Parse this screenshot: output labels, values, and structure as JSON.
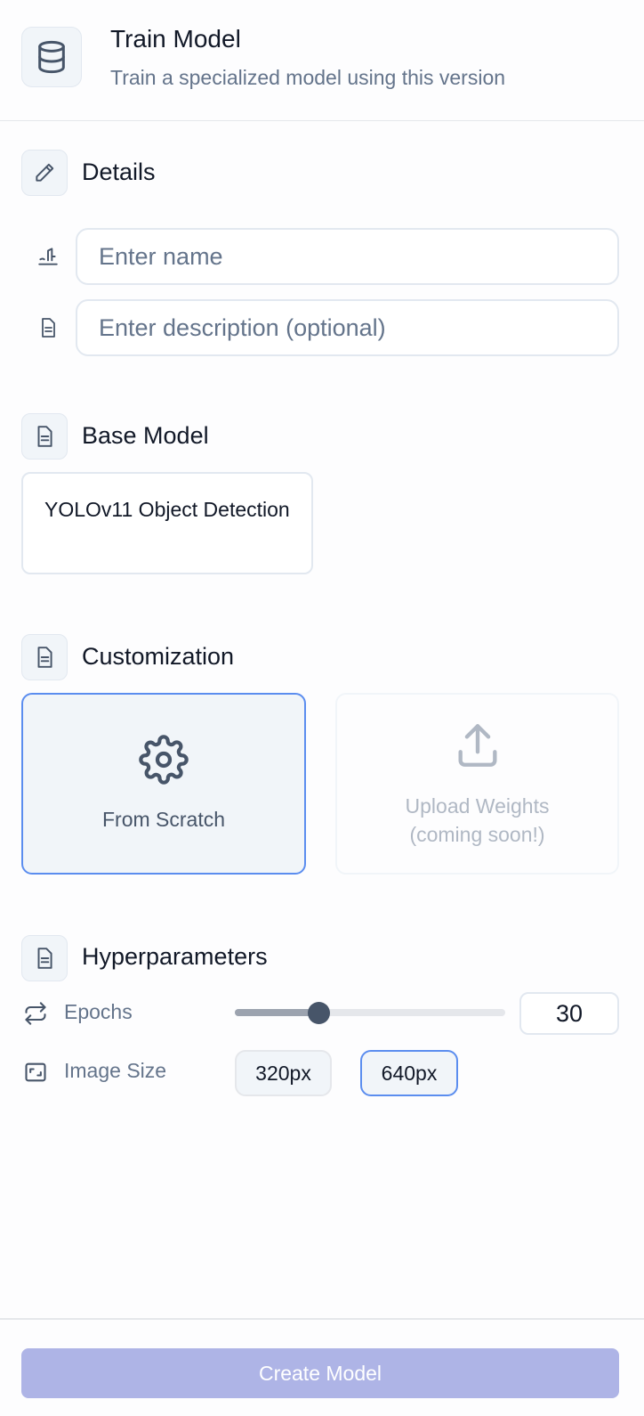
{
  "header": {
    "title": "Train Model",
    "subtitle": "Train a specialized model using this version",
    "icon": "database-icon"
  },
  "details": {
    "title": "Details",
    "icon": "pencil-icon",
    "name_field": {
      "placeholder": "Enter name",
      "value": "",
      "icon": "signature-icon"
    },
    "description_field": {
      "placeholder": "Enter description (optional)",
      "value": "",
      "icon": "document-icon"
    }
  },
  "base_model": {
    "title": "Base Model",
    "icon": "document-icon",
    "selected": "YOLOv11 Object Detection"
  },
  "customization": {
    "title": "Customization",
    "icon": "document-icon",
    "options": [
      {
        "label": "From Scratch",
        "icon": "gear-icon",
        "state": "selected"
      },
      {
        "label": "Upload Weights (coming soon!)",
        "icon": "upload-icon",
        "state": "disabled"
      }
    ]
  },
  "hyperparameters": {
    "title": "Hyperparameters",
    "icon": "document-icon",
    "epochs": {
      "label": "Epochs",
      "value": "30",
      "slider_fraction": 0.31,
      "icon": "repeat-icon"
    },
    "image_size": {
      "label": "Image Size",
      "icon": "image-aspect-icon",
      "options": [
        "320px",
        "640px"
      ],
      "selected": "640px"
    }
  },
  "footer": {
    "create_label": "Create Model"
  },
  "colors": {
    "accent": "#5b8def",
    "button_disabled": "#aeb4e6",
    "muted_text": "#64748b"
  }
}
